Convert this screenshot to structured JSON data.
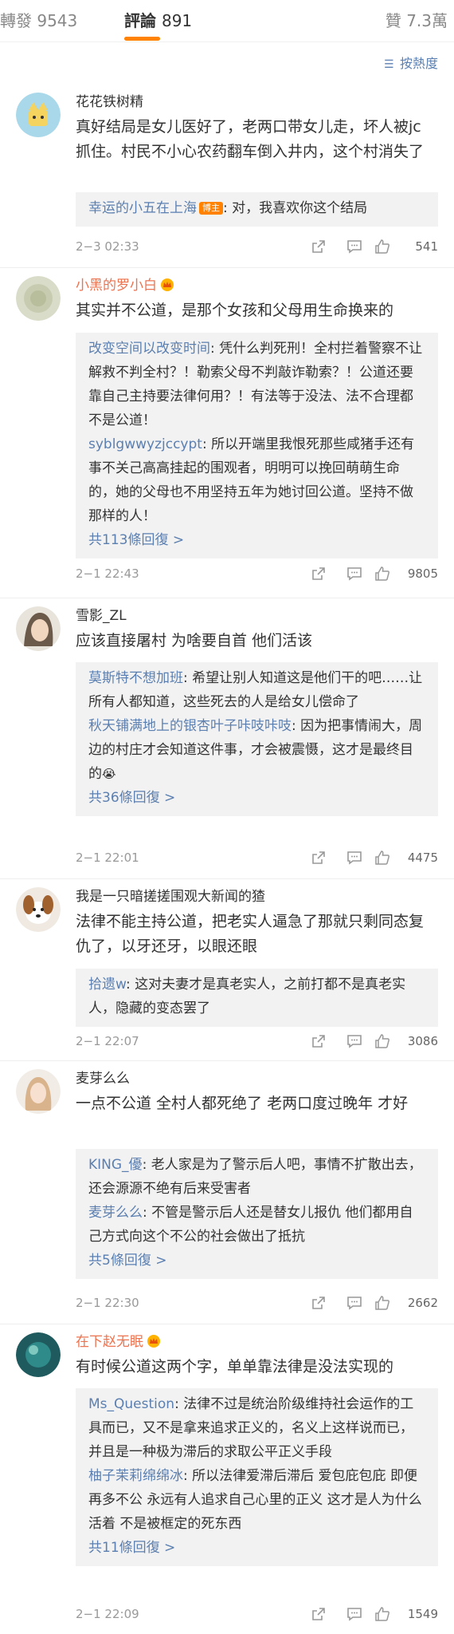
{
  "tabs": {
    "repost_label": "轉發",
    "repost_count": "9543",
    "comments_label": "評論",
    "comments_count": "891",
    "likes_label": "贊",
    "likes_count": "7.3萬"
  },
  "sort": {
    "label": "按熱度",
    "icon": "sort-lines-icon"
  },
  "colors": {
    "accent": "#ff8200",
    "link": "#5b7fb0",
    "vip_name": "#eb7350"
  },
  "comments": [
    {
      "username": "花花铁树精",
      "content": "真好结局是女儿医好了，老两口带女儿走，坏人被jc抓住。村民不小心农药翻车倒入井内，这个村消失了",
      "replies": [
        {
          "name": "幸运的小五在上海",
          "badge": "博主",
          "text": ": 对，我喜欢你这个结局"
        }
      ],
      "time": "2−3 02:33",
      "likes": "541"
    },
    {
      "username": "小黑的罗小白",
      "vip": true,
      "content": "其实并不公道，是那个女孩和父母用生命换来的",
      "replies": [
        {
          "name": "改变空间以改变时间",
          "text": ": 凭什么判死刑！全村拦着警察不让解救不判全村？！勒索父母不判敲诈勒索？！公道还要靠自己主持要法律何用？！有法等于没法、法不合理都不是公道！"
        },
        {
          "name": "syblgwwyzjccypt",
          "text": ": 所以开端里我恨死那些咸猪手还有事不关己高高挂起的围观者，明明可以挽回萌萌生命的，她的父母也不用坚持五年为她讨回公道。坚持不做那样的人！"
        }
      ],
      "more": "共113條回復 >",
      "time": "2−1 22:43",
      "likes": "9805"
    },
    {
      "username": "雪影_ZL",
      "content": "应该直接屠村 为啥要自首 他们活该",
      "replies": [
        {
          "name": "莫斯特不想加班",
          "text": ": 希望让别人知道这是他们干的吧……让所有人都知道，这些死去的人是给女儿偿命了"
        },
        {
          "name": "秋天铺满地上的银杏叶子咔吱咔吱",
          "text": ": 因为把事情闹大，周边的村庄才会知道这件事，才会被震慑，这才是最终目的",
          "emoji": "😭"
        }
      ],
      "more": "共36條回復 >",
      "time": "2−1 22:01",
      "likes": "4475"
    },
    {
      "username": "我是一只暗搓搓围观大新闻的猹",
      "content": "法律不能主持公道，把老实人逼急了那就只剩同态复仇了，以牙还牙，以眼还眼",
      "replies": [
        {
          "name": "拾遗w",
          "text": ": 这对夫妻才是真老实人，之前打都不是真老实人，隐藏的变态罢了"
        }
      ],
      "time": "2−1 22:07",
      "likes": "3086"
    },
    {
      "username": "麦芽么么",
      "content": "一点不公道 全村人都死绝了 老两口度过晚年 才好",
      "replies": [
        {
          "name": "KING_優",
          "text": ": 老人家是为了警示后人吧，事情不扩散出去，还会源源不绝有后来受害者"
        },
        {
          "name": "麦芽么么",
          "text": ": 不管是警示后人还是替女儿报仇 他们都用自己方式向这个不公的社会做出了抵抗"
        }
      ],
      "more": "共5條回復 >",
      "time": "2−1 22:30",
      "likes": "2662"
    },
    {
      "username": "在下赵无眠",
      "vip": true,
      "content": "有时候公道这两个字，单单靠法律是没法实现的",
      "replies": [
        {
          "name": "Ms_Question",
          "text": ": 法律不过是统治阶级维持社会运作的工具而已，又不是拿来追求正义的，名义上这样说而已，并且是一种极为滞后的求取公平正义手段"
        },
        {
          "name": "柚子茉莉绵绵冰",
          "text": ": 所以法律爱滞后滞后 爱包庇包庇 即便再多不公 永远有人追求自己心里的正义 这才是人为什么活着 不是被框定的死东西"
        }
      ],
      "more": "共11條回復 >",
      "time": "2−1 22:09",
      "likes": "1549"
    }
  ]
}
